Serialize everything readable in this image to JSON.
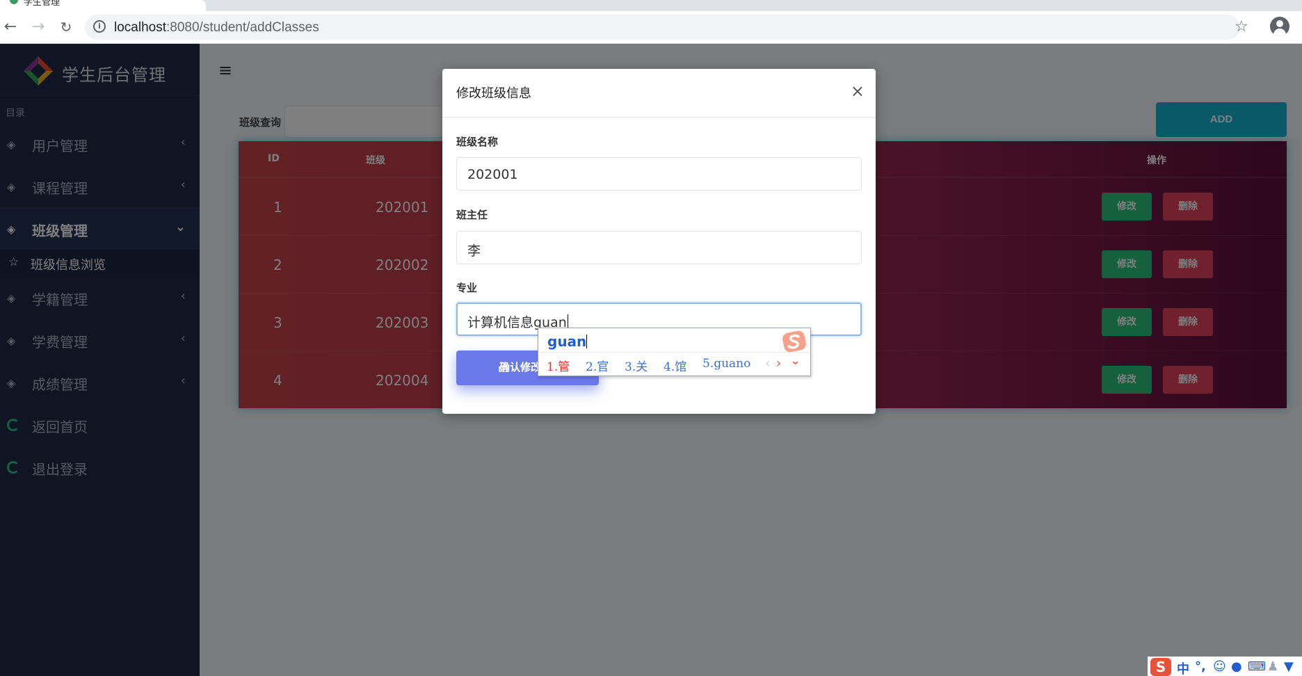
{
  "browser": {
    "tab_title": "学生管理",
    "url_host": "localhost",
    "url_path": ":8080/student/addClasses"
  },
  "sidebar": {
    "brand_title": "学生后台管理",
    "heading": "目录",
    "items": [
      {
        "label": "用户管理"
      },
      {
        "label": "课程管理"
      },
      {
        "label": "班级管理"
      },
      {
        "label": "学籍管理"
      },
      {
        "label": "学费管理"
      },
      {
        "label": "成绩管理"
      },
      {
        "label": "返回首页"
      },
      {
        "label": "退出登录"
      }
    ],
    "submenu": {
      "label": "班级信息浏览"
    }
  },
  "main": {
    "search_label": "班级查询",
    "add_label": "ADD",
    "table": {
      "headers": [
        "ID",
        "班级",
        "操作"
      ],
      "rows": [
        {
          "id": "1",
          "class": "202001"
        },
        {
          "id": "2",
          "class": "202002"
        },
        {
          "id": "3",
          "class": "202003"
        },
        {
          "id": "4",
          "class": "202004"
        }
      ],
      "edit_label": "修改",
      "delete_label": "删除"
    }
  },
  "modal": {
    "title": "修改班级信息",
    "close": "×",
    "fields": {
      "class_name": {
        "label": "班级名称",
        "value": "202001"
      },
      "teacher": {
        "label": "班主任",
        "value": "李"
      },
      "major": {
        "label": "专业",
        "value": "计算机信息guan"
      }
    },
    "confirm_label": "确认修改"
  },
  "ime": {
    "composition": "guan",
    "candidates": [
      "1.管",
      "2.官",
      "3.关",
      "4.馆",
      "5.guano"
    ]
  },
  "tray": {
    "lang": "中",
    "punct": "°,"
  },
  "colors": {
    "sidebar_bg": "#1e2a45",
    "add_button": "#17b3d0",
    "edit_button": "#2bc07a",
    "delete_button": "#e0425a",
    "confirm_button": "#6a79e8"
  }
}
